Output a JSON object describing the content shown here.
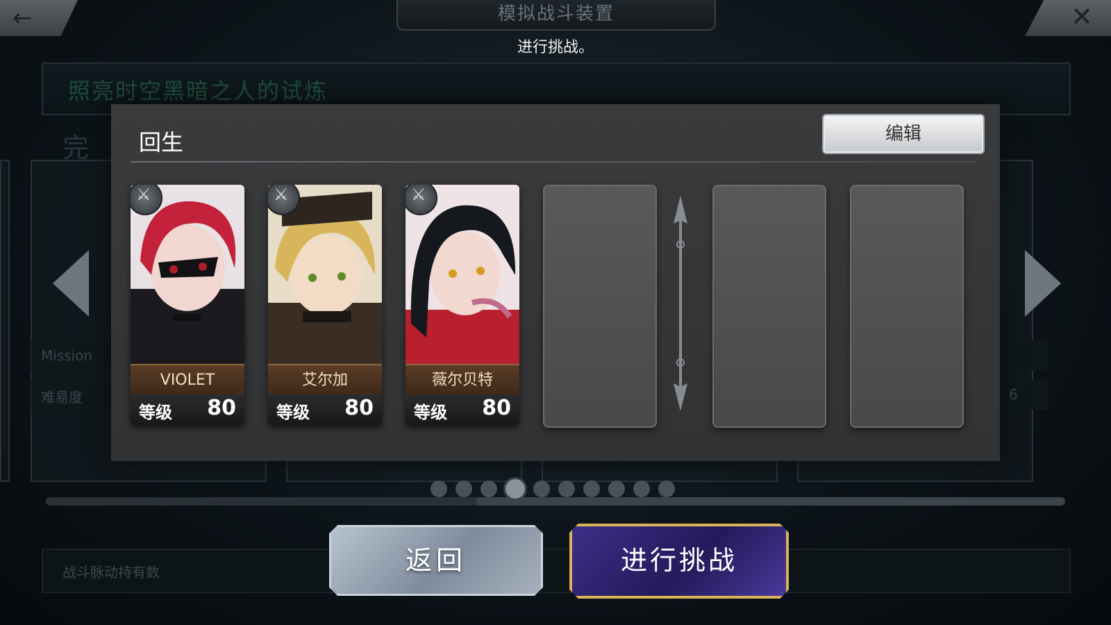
{
  "header": {
    "back_icon": "←",
    "title": "模拟战斗装置",
    "close_icon": "✕",
    "subtitle": "进行挑战。"
  },
  "background": {
    "trial_name": "照亮时空黑暗之人的试炼",
    "complete_label": "完",
    "mission_label": "Mission",
    "difficulty_label": "难易度",
    "difficulty_value": "6",
    "battle_pulse_label": "战斗脉动持有数"
  },
  "party": {
    "title": "回生",
    "edit_label": "编辑",
    "units": [
      {
        "name": "VIOLET",
        "level_label": "等级",
        "level": "80"
      },
      {
        "name": "艾尔加",
        "level_label": "等级",
        "level": "80"
      },
      {
        "name": "薇尔贝特",
        "level_label": "等级",
        "level": "80"
      }
    ],
    "empty_slots": 3
  },
  "pagination": {
    "total": 10,
    "active_index": 3
  },
  "buttons": {
    "return_label": "返回",
    "challenge_label": "进行挑战"
  },
  "colors": {
    "accent_gold": "#d9b45a",
    "challenge_purple": "#3c2f88",
    "name_plate": "#5a3d26"
  }
}
